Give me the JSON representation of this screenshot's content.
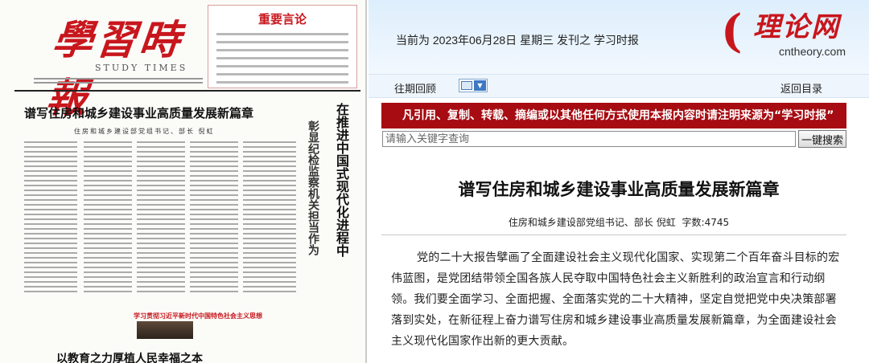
{
  "newspaper": {
    "masthead_logo": "學習時報",
    "masthead_subtitle": "STUDY TIMES",
    "quote_box_title": "重要言论",
    "headline": "谱写住房和城乡建设事业高质量发展新篇章",
    "byline": "住房和城乡建设部党组书记、部长  倪虹",
    "vertical_headline": "在推进中国式现代化进程中",
    "vertical_subheadline": "彰显纪检监察机关担当作为",
    "red_caption": "学习贯彻习近平新时代中国特色社会主义思想",
    "footer_headline": "以教育之力厚植人民幸福之本"
  },
  "header": {
    "date_line": "当前为 2023年06月28日 星期三 发刊之 学习时报",
    "brand_mark": "(",
    "brand_name": "理论网",
    "brand_domain": "cntheory.com"
  },
  "nav": {
    "archive_label": "往期回顾",
    "back_label": "返回目录"
  },
  "notice": {
    "text": "凡引用、复制、转载、摘编或以其他任何方式使用本报内容时请注明来源为“学习时报”"
  },
  "search": {
    "placeholder": "请输入关键字查询",
    "button_label": "一键搜索"
  },
  "article": {
    "title": "谱写住房和城乡建设事业高质量发展新篇章",
    "author": "住房和城乡建设部党组书记、部长 倪虹",
    "word_count": "字数:4745",
    "body": "党的二十大报告擘画了全面建设社会主义现代化国家、实现第二个百年奋斗目标的宏伟蓝图，是党团结带领全国各族人民夺取中国特色社会主义新胜利的政治宣言和行动纲领。我们要全面学习、全面把握、全面落实党的二十大精神，坚定自觉把党中央决策部署落到实处，在新征程上奋力谱写住房和城乡建设事业高质量发展新篇章，为全面建设社会主义现代化国家作出新的更大贡献。"
  },
  "colors": {
    "brand_red": "#c8161d",
    "notice_bg": "#a60c12",
    "header_bg": "#ddeefc"
  }
}
